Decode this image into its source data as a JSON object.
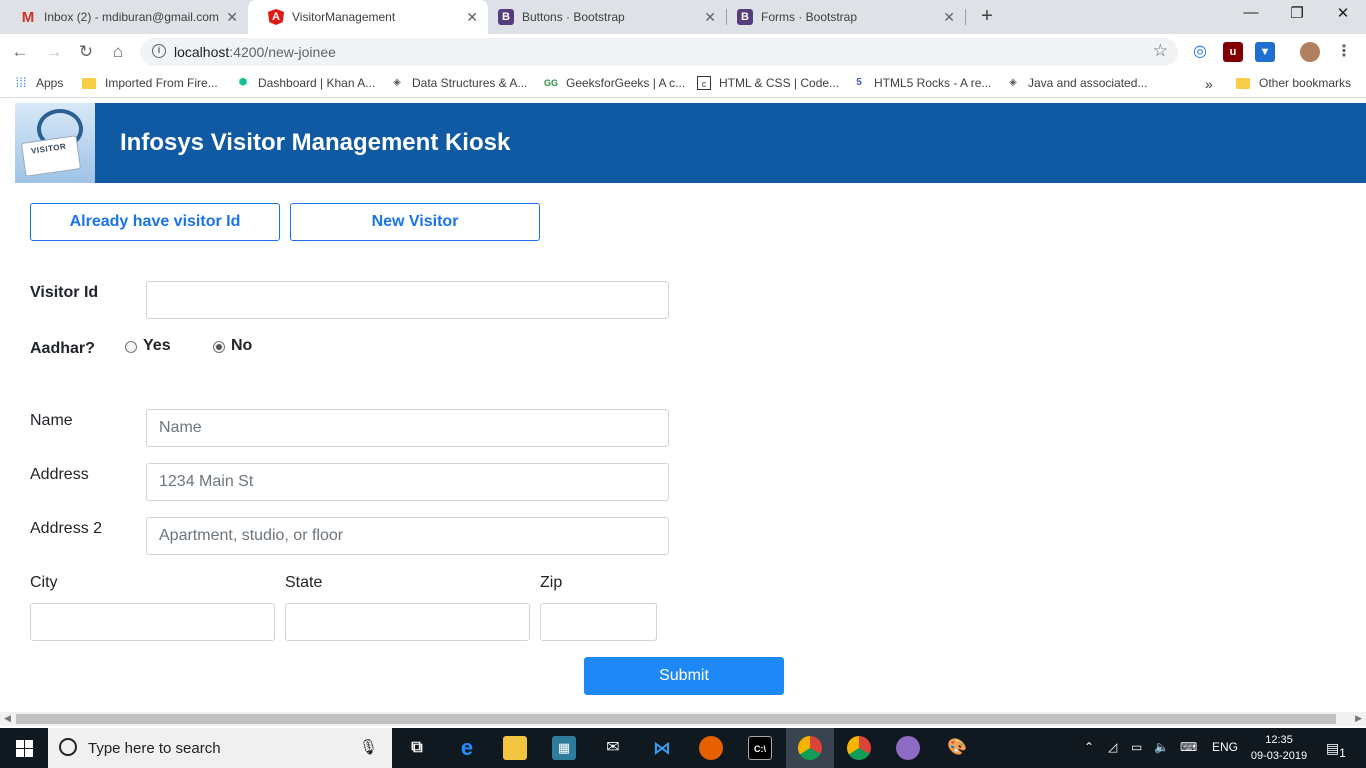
{
  "browser": {
    "tabs": [
      {
        "title": "Inbox (2) - mdiburan@gmail.com",
        "icon": "gmail-icon"
      },
      {
        "title": "VisitorManagement",
        "icon": "angular-icon"
      },
      {
        "title": "Buttons · Bootstrap",
        "icon": "bootstrap-icon"
      },
      {
        "title": "Forms · Bootstrap",
        "icon": "bootstrap-icon"
      }
    ],
    "url_host": "localhost",
    "url_path": ":4200/new-joinee",
    "bookmarks": [
      {
        "label": "Apps"
      },
      {
        "label": "Imported From Fire..."
      },
      {
        "label": "Dashboard | Khan A..."
      },
      {
        "label": "Data Structures & A..."
      },
      {
        "label": "GeeksforGeeks | A c..."
      },
      {
        "label": "HTML & CSS | Code..."
      },
      {
        "label": "HTML5 Rocks - A re..."
      },
      {
        "label": "Java and associated..."
      }
    ],
    "overflow": "»",
    "other_bookmarks": "Other bookmarks"
  },
  "header": {
    "logo_text": "VISITOR",
    "title": "Infosys Visitor Management Kiosk"
  },
  "form": {
    "already_button": "Already have visitor Id",
    "new_button": "New Visitor",
    "visitor_id_label": "Visitor Id",
    "visitor_id_value": "",
    "aadhar_label": "Aadhar?",
    "aadhar_yes": "Yes",
    "aadhar_no": "No",
    "aadhar_selected": "No",
    "name_label": "Name",
    "name_placeholder": "Name",
    "address_label": "Address",
    "address_placeholder": "1234 Main St",
    "address2_label": "Address 2",
    "address2_placeholder": "Apartment, studio, or floor",
    "city_label": "City",
    "state_label": "State",
    "zip_label": "Zip",
    "submit": "Submit"
  },
  "taskbar": {
    "search_placeholder": "Type here to search",
    "language": "ENG",
    "time": "12:35",
    "date": "09-03-2019",
    "notifications": "1"
  },
  "colors": {
    "header_bg": "#0f5aa3",
    "primary": "#1e88f6",
    "outline": "#1a73e8"
  }
}
